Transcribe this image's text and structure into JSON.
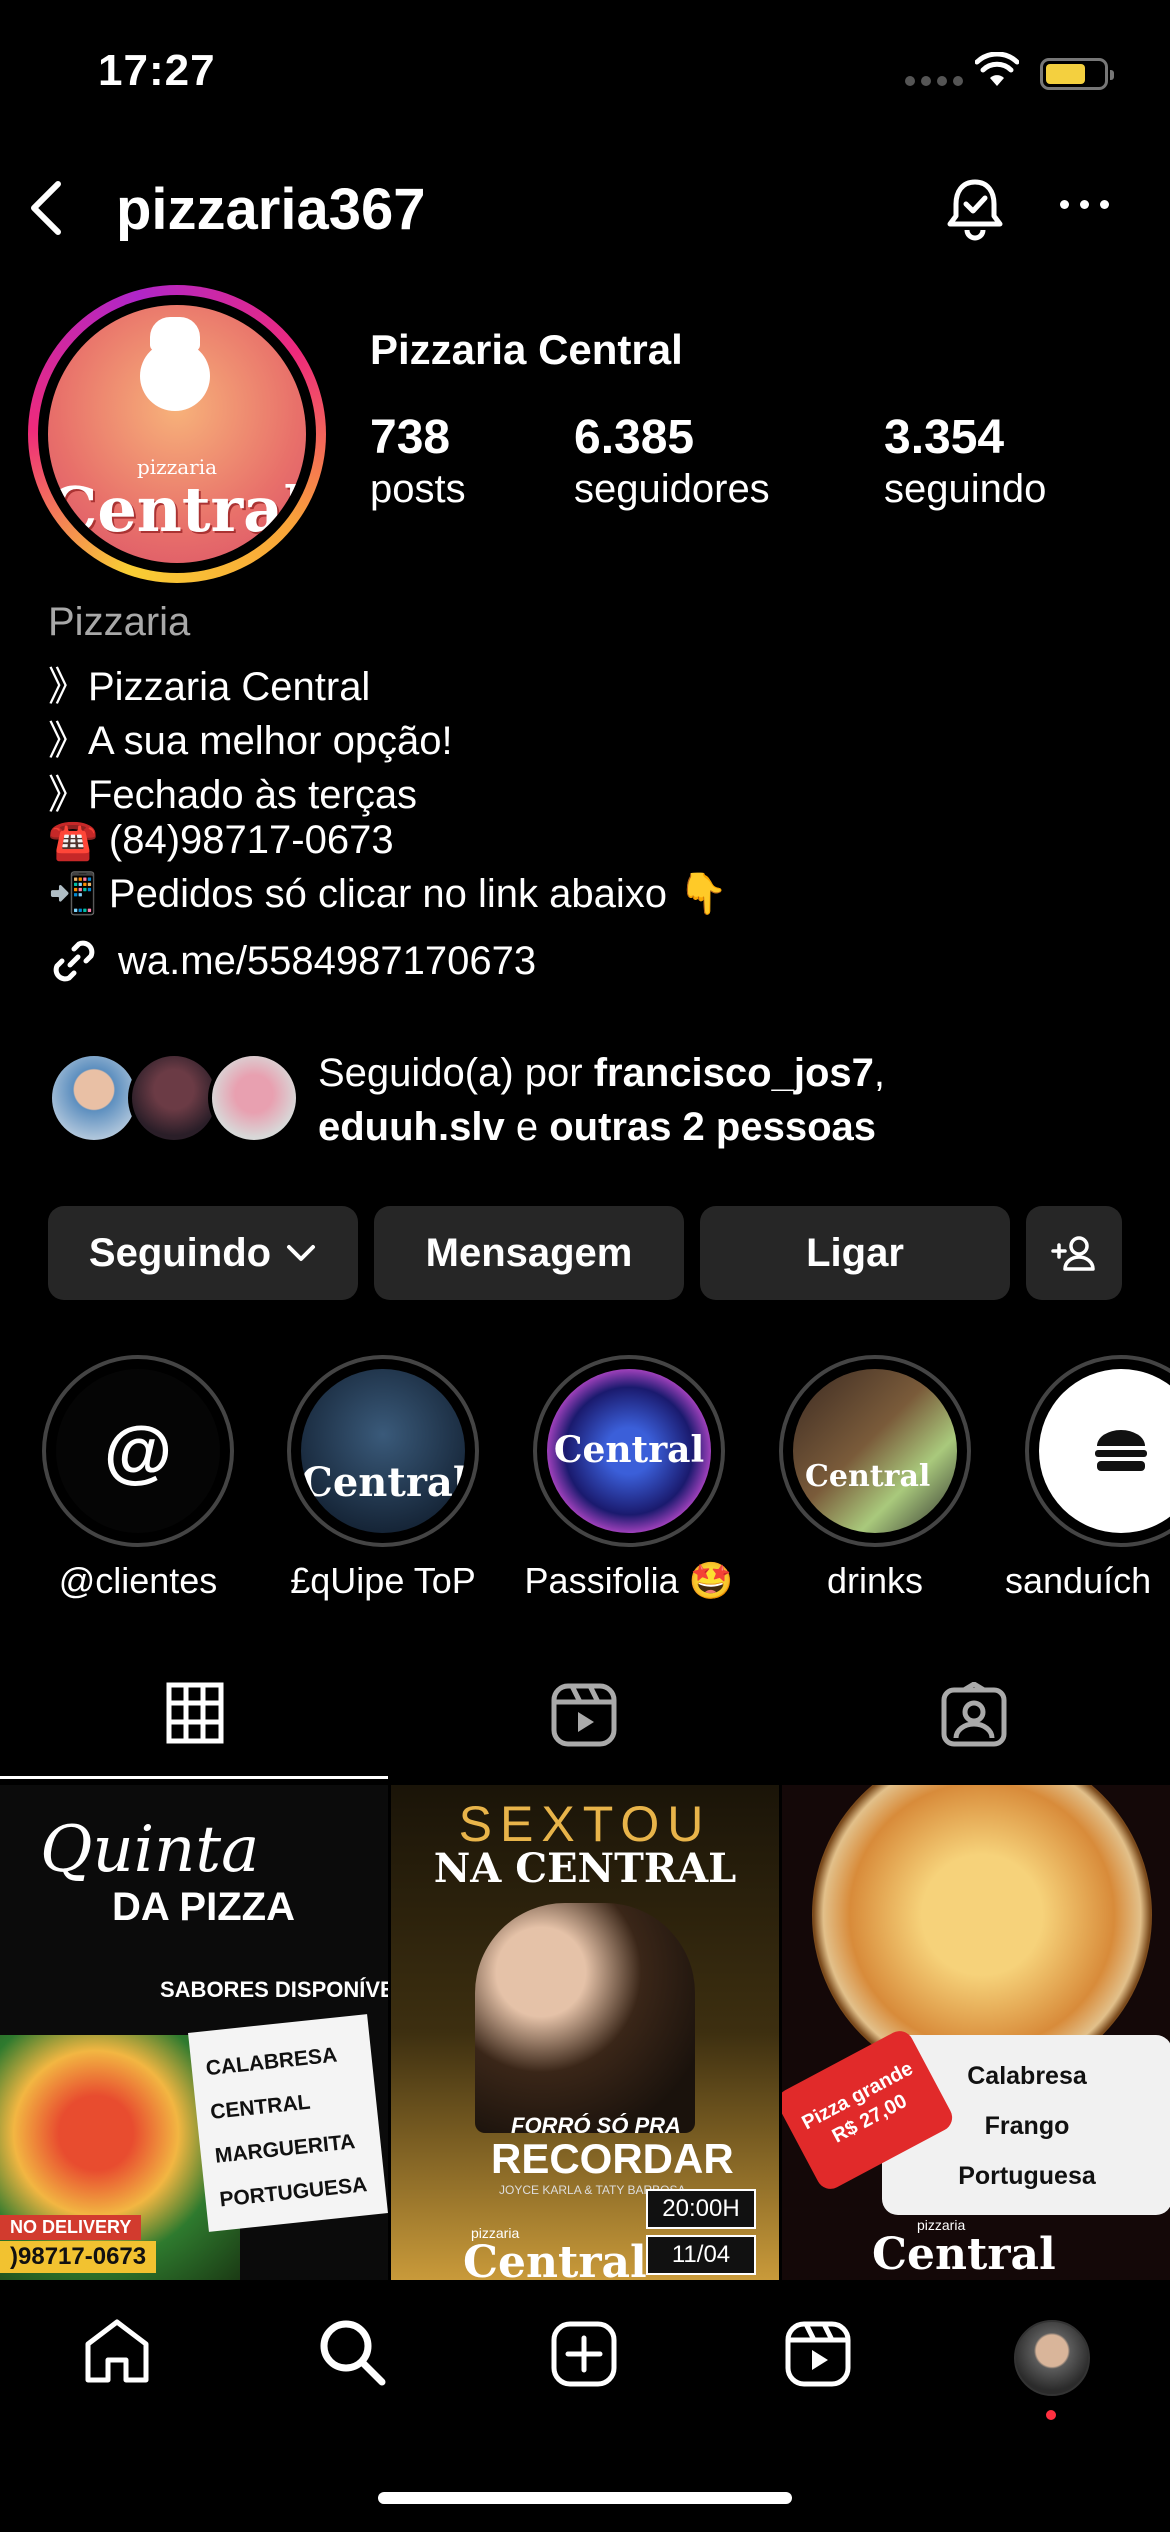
{
  "status_bar": {
    "time": "17:27"
  },
  "header": {
    "username": "pizzaria367"
  },
  "profile": {
    "avatar_text_small": "pizzaria",
    "avatar_text_big": "Central",
    "display_name": "Pizzaria Central",
    "stats": [
      {
        "value": "738",
        "label": "posts"
      },
      {
        "value": "6.385",
        "label": "seguidores"
      },
      {
        "value": "3.354",
        "label": "seguindo"
      }
    ],
    "category": "Pizzaria",
    "bio": [
      "》Pizzaria Central",
      "》A sua melhor opção!",
      "》Fechado às terças",
      "☎️ (84)98717-0673",
      "📲 Pedidos só clicar no link abaixo 👇"
    ],
    "link": "wa.me/5584987170673"
  },
  "followed_by": {
    "prefix": "Seguido(a) por ",
    "user1": "francisco_jos7",
    "sep1": ",",
    "user2": "eduuh.slv",
    "sep2": " e ",
    "others": "outras 2 pessoas"
  },
  "buttons": {
    "following": "Seguindo",
    "message": "Mensagem",
    "call": "Ligar"
  },
  "highlights": [
    {
      "label": "@clientes",
      "text": "@"
    },
    {
      "label": "£qUipe ToP",
      "text": "Central"
    },
    {
      "label": "Passifolia 🤩",
      "text": "Central"
    },
    {
      "label": "drinks",
      "text": "Central"
    },
    {
      "label": "sanduích",
      "text": ""
    }
  ],
  "posts": [
    {
      "title1": "Quinta",
      "title2": "DA PIZZA",
      "subtitle": "SABORES DISPONÍVE",
      "flavors": [
        "CALABRESA",
        "CENTRAL",
        "MARGUERITA",
        "PORTUGUESA"
      ],
      "badge": "NO DELIVERY",
      "phone": ")98717-0673"
    },
    {
      "title1": "SEXTOU",
      "title2": "NA CENTRAL",
      "event": "FORRÓ SÓ PRA",
      "event2": "RECORDAR",
      "artists": "JOYCE KARLA & TATY BARBOSA",
      "time": "20:00H",
      "date": "11/04",
      "brand_small": "pizzaria",
      "brand": "Central"
    },
    {
      "flavors": [
        "Calabresa",
        "Frango",
        "Portuguesa"
      ],
      "promo1": "Pizza grande",
      "promo2": "R$ 27,00",
      "brand_small": "pizzaria",
      "brand": "Central"
    }
  ]
}
